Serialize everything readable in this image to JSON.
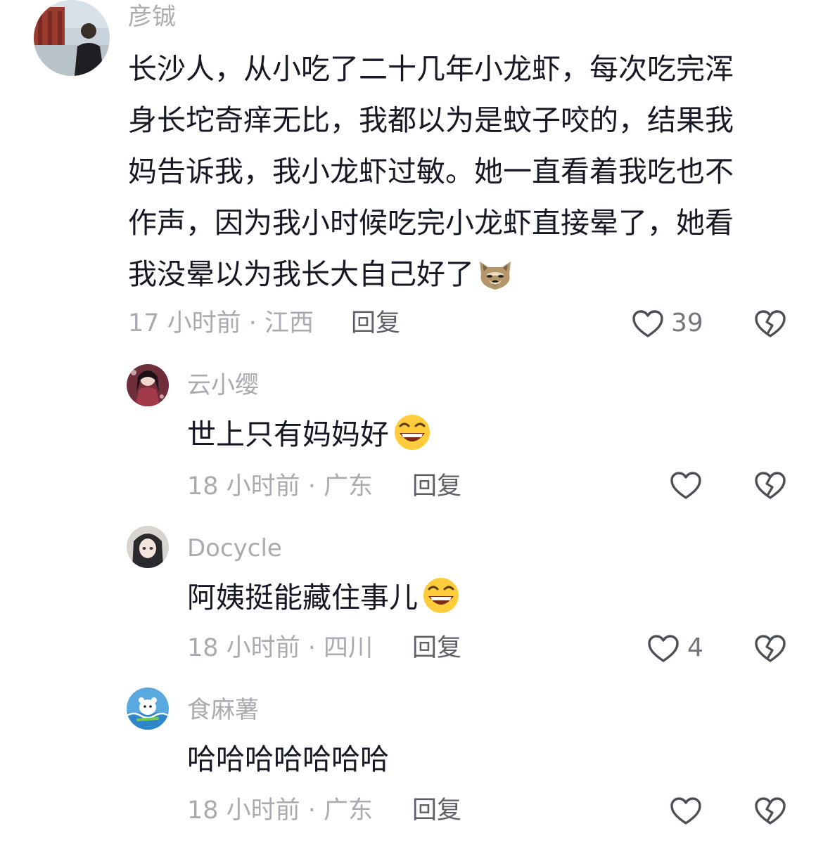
{
  "comments": [
    {
      "username": "彦铖",
      "lines": [
        "长沙人，从小吃了二十几年小龙虾，每次吃完浑",
        "身长坨奇痒无比，我都以为是蚊子咬的，结果我",
        "妈告诉我，我小龙虾过敏。她一直看着我吃也不",
        "作声，因为我小时候吃完小龙虾直接晕了，她看",
        "我没晕以为我长大自己好了"
      ],
      "trailing_emoji": "dog-face-emoji",
      "meta": "17 小时前 · 江西",
      "reply_label": "回复",
      "likes": "39"
    },
    {
      "username": "云小缨",
      "text": "世上只有妈妈好",
      "trailing_emoji": "grinning-emoji",
      "meta": "18 小时前 · 广东",
      "reply_label": "回复",
      "likes": ""
    },
    {
      "username": "Docycle",
      "text": "阿姨挺能藏住事儿",
      "trailing_emoji": "grinning-emoji",
      "meta": "18 小时前 · 四川",
      "reply_label": "回复",
      "likes": "4"
    },
    {
      "username": "食麻薯",
      "text": "哈哈哈哈哈哈哈",
      "meta": "18 小时前 · 广东",
      "reply_label": "回复",
      "likes": ""
    }
  ],
  "icons": {
    "like": "heart-outline-icon",
    "dislike": "broken-heart-icon"
  },
  "colors": {
    "text": "#161823",
    "secondary": "#a9abb0",
    "reply": "#5e6068",
    "icon": "#4d4f56"
  }
}
